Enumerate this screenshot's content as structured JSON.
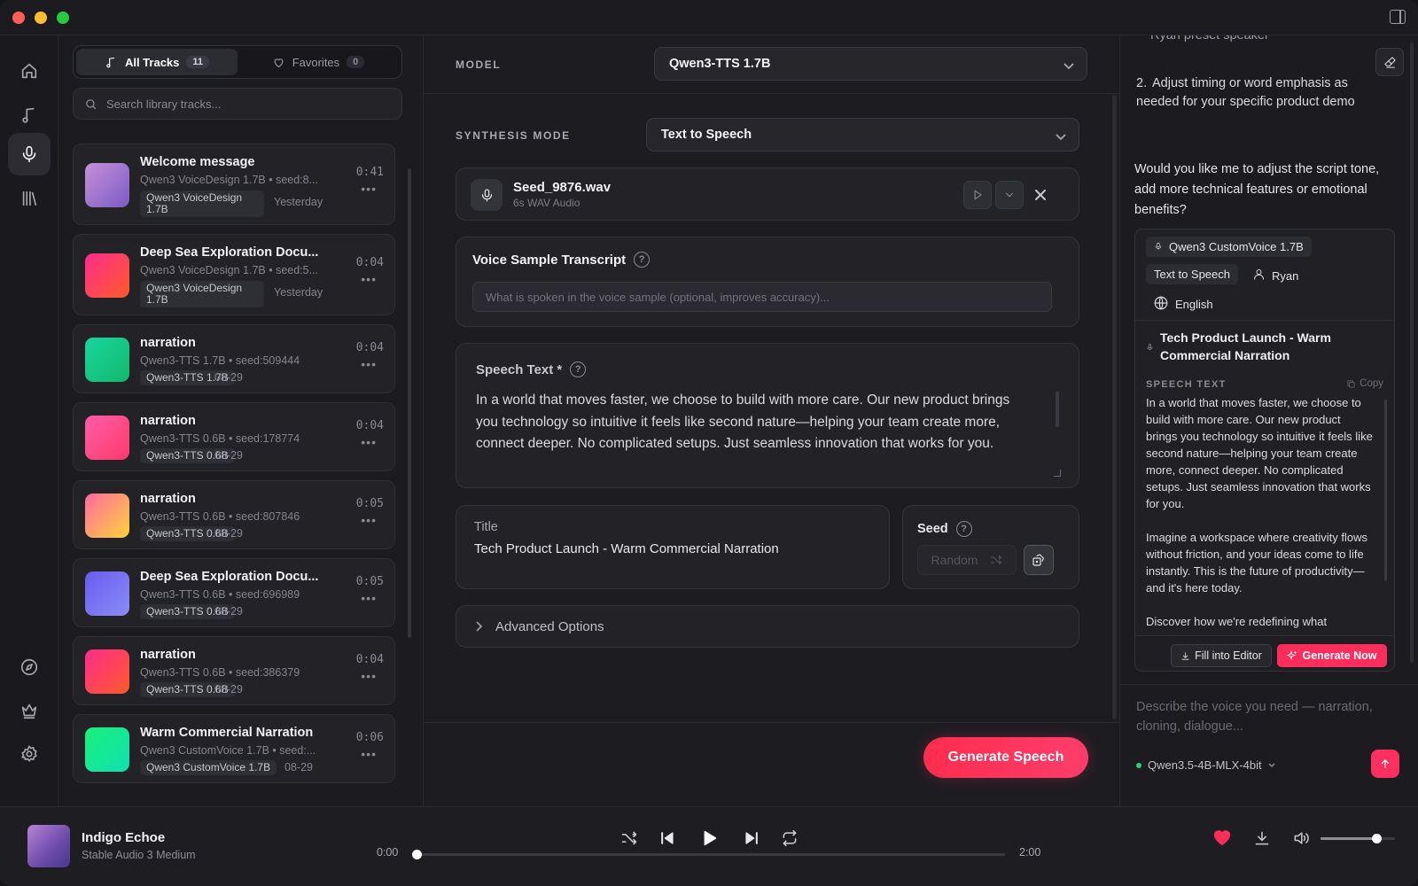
{
  "library": {
    "tabs": [
      {
        "label": "All Tracks",
        "count": "11",
        "icon": "music-note-icon"
      },
      {
        "label": "Favorites",
        "count": "0",
        "icon": "heart-outline-icon"
      }
    ],
    "search_placeholder": "Search library tracks...",
    "tracks": [
      {
        "title": "Welcome message",
        "sub": "Qwen3 VoiceDesign 1.7B • seed:8...",
        "tag": "Qwen3 VoiceDesign 1.7B",
        "date": "Yesterday",
        "duration": "0:41",
        "gradient": "linear-gradient(135deg,#c78fd8,#7a5bc4)",
        "tall": true
      },
      {
        "title": "Deep Sea Exploration Docu...",
        "sub": "Qwen3 VoiceDesign 1.7B • seed:5...",
        "tag": "Qwen3 VoiceDesign 1.7B",
        "date": "Yesterday",
        "duration": "0:04",
        "gradient": "linear-gradient(135deg,#ff2d8a,#ff5a2a)",
        "tall": true
      },
      {
        "title": "narration",
        "sub": "Qwen3-TTS 1.7B • seed:509444",
        "tag": "Qwen3-TTS 1.7B",
        "date": "08-29",
        "duration": "0:04",
        "gradient": "linear-gradient(135deg,#18d6a0,#13b86a)",
        "tall": false
      },
      {
        "title": "narration",
        "sub": "Qwen3-TTS 0.6B • seed:178774",
        "tag": "Qwen3-TTS 0.6B",
        "date": "08-29",
        "duration": "0:04",
        "gradient": "linear-gradient(135deg,#ff5ca8,#ff3a6a)",
        "tall": false
      },
      {
        "title": "narration",
        "sub": "Qwen3-TTS 0.6B • seed:807846",
        "tag": "Qwen3-TTS 0.6B",
        "date": "08-29",
        "duration": "0:05",
        "gradient": "linear-gradient(135deg,#ff6aa0,#ffd23a)",
        "tall": false
      },
      {
        "title": "Deep Sea Exploration Docu...",
        "sub": "Qwen3-TTS 0.6B • seed:696989",
        "tag": "Qwen3-TTS 0.6B",
        "date": "08-29",
        "duration": "0:05",
        "gradient": "linear-gradient(135deg,#6a5cf0,#8a8cf8)",
        "tall": false
      },
      {
        "title": "narration",
        "sub": "Qwen3-TTS 0.6B • seed:386379",
        "tag": "Qwen3-TTS 0.6B",
        "date": "08-29",
        "duration": "0:04",
        "gradient": "linear-gradient(135deg,#ff2d8a,#ff5a2a)",
        "tall": false
      },
      {
        "title": "Warm Commercial Narration",
        "sub": "Qwen3 CustomVoice 1.7B • seed:...",
        "tag": "Qwen3 CustomVoice 1.7B",
        "date": "08-29",
        "duration": "0:06",
        "gradient": "linear-gradient(135deg,#1af07a,#10e0b0)",
        "tall": false
      }
    ]
  },
  "center": {
    "model_label": "MODEL",
    "model_value": "Qwen3-TTS 1.7B",
    "mode_label": "SYNTHESIS MODE",
    "mode_value": "Text to Speech",
    "seed_file": {
      "name": "Seed_9876.wav",
      "meta": "6s WAV Audio"
    },
    "transcript": {
      "title": "Voice Sample Transcript",
      "placeholder": "What is spoken in the voice sample (optional, improves accuracy)..."
    },
    "speech": {
      "title": "Speech Text *",
      "text": "In a world that moves faster, we choose to build with more care. Our new product brings you technology so intuitive it feels like second nature—helping your team create more, connect deeper. No complicated setups. Just seamless innovation that works for you."
    },
    "title_field": {
      "label": "Title",
      "value": "Tech Product Launch - Warm Commercial Narration"
    },
    "seed": {
      "label": "Seed",
      "random_label": "Random"
    },
    "advanced_label": "Advanced Options",
    "generate_label": "Generate Speech"
  },
  "assistant": {
    "clipped_top": "Ryan preset speaker",
    "list_item_num": "2.",
    "list_item_text": "Adjust timing or word emphasis as needed for your specific product demo",
    "question": "Would you like me to adjust the script tone, add more technical features or emotional benefits?",
    "card": {
      "model": "Qwen3 CustomVoice 1.7B",
      "mode": "Text to Speech",
      "speaker": "Ryan",
      "language": "English",
      "title": "Tech Product Launch - Warm Commercial Narration",
      "speech_caption": "SPEECH TEXT",
      "copy_label": "Copy",
      "paragraphs": [
        "In a world that moves faster, we choose to build with more care. Our new product brings you technology so intuitive it feels like second nature—helping your team create more, connect deeper. No complicated setups. Just seamless innovation that works for you.",
        "Imagine a workspace where creativity flows without friction, and your ideas come to life instantly. This is the future of productivity—and it's here today.",
        "Discover how we're redefining what"
      ],
      "fill_label": "Fill into Editor",
      "generate_label": "Generate Now"
    },
    "compose_placeholder": "Describe the voice you need — narration, cloning, dialogue...",
    "compose_model": "Qwen3.5-4B-MLX-4bit"
  },
  "player": {
    "title": "Indigo Echoe",
    "subtitle": "Stable Audio 3 Medium",
    "elapsed": "0:00",
    "total": "2:00",
    "progress": 0,
    "volume": 0.75
  },
  "colors": {
    "accent": "#ff2d5c",
    "favorite": "#ff2d5c"
  }
}
